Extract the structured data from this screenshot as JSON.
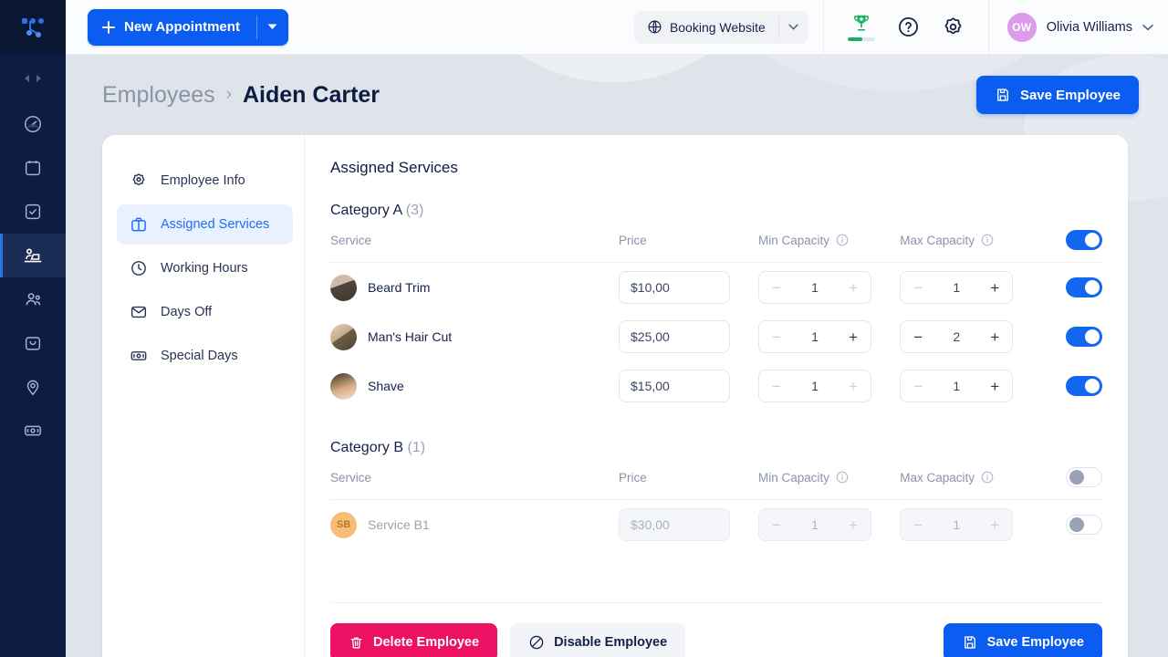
{
  "rail": {
    "logo_name": "app-logo",
    "collapse_label": "collapse-sidebar",
    "items": [
      {
        "name": "dashboard",
        "icon": "speedometer-icon",
        "active": false
      },
      {
        "name": "calendar",
        "icon": "calendar-icon",
        "active": false
      },
      {
        "name": "tasks",
        "icon": "checkbox-icon",
        "active": false
      },
      {
        "name": "employees",
        "icon": "employee-icon",
        "active": true
      },
      {
        "name": "customers",
        "icon": "customers-icon",
        "active": false
      },
      {
        "name": "packages",
        "icon": "box-icon",
        "active": false
      },
      {
        "name": "locations",
        "icon": "location-pin-icon",
        "active": false
      },
      {
        "name": "finance",
        "icon": "banknote-icon",
        "active": false
      }
    ]
  },
  "topbar": {
    "new_appointment_label": "New Appointment",
    "booking_website_label": "Booking Website",
    "trophy_progress_percent": 55,
    "user": {
      "initials": "OW",
      "name": "Olivia Williams",
      "avatar_color": "#dd9ce9"
    }
  },
  "page_header": {
    "breadcrumb_parent": "Employees",
    "breadcrumb_separator": "›",
    "breadcrumb_current": "Aiden Carter",
    "save_label": "Save Employee"
  },
  "card_nav": {
    "items": [
      {
        "label": "Employee Info",
        "icon": "gear-icon",
        "active": false
      },
      {
        "label": "Assigned Services",
        "icon": "briefcase-icon",
        "active": true
      },
      {
        "label": "Working Hours",
        "icon": "clock-icon",
        "active": false
      },
      {
        "label": "Days Off",
        "icon": "envelope-icon",
        "active": false
      },
      {
        "label": "Special Days",
        "icon": "banknote-icon",
        "active": false
      }
    ]
  },
  "content": {
    "title": "Assigned Services",
    "columns": {
      "service": "Service",
      "price": "Price",
      "min_capacity": "Min Capacity",
      "max_capacity": "Max Capacity"
    },
    "categories": [
      {
        "name": "Category A",
        "count": "(3)",
        "enabled": true,
        "header_toggle_on": true,
        "rows": [
          {
            "service": "Beard Trim",
            "avatar_type": "photo",
            "avatar_colors": [
              "#5a5246",
              "#c9b9a6"
            ],
            "price": "$10,00",
            "min_capacity": "1",
            "min_minus_enabled": false,
            "min_plus_enabled": false,
            "max_capacity": "1",
            "max_minus_enabled": false,
            "max_plus_enabled": true,
            "toggle_on": true
          },
          {
            "service": "Man's Hair Cut",
            "avatar_type": "photo",
            "avatar_colors": [
              "#8b7a63",
              "#d8c6ad"
            ],
            "price": "$25,00",
            "min_capacity": "1",
            "min_minus_enabled": false,
            "min_plus_enabled": true,
            "max_capacity": "2",
            "max_minus_enabled": true,
            "max_plus_enabled": true,
            "toggle_on": true
          },
          {
            "service": "Shave",
            "avatar_type": "photo",
            "avatar_colors": [
              "#c9a07a",
              "#7a6a55"
            ],
            "price": "$15,00",
            "min_capacity": "1",
            "min_minus_enabled": false,
            "min_plus_enabled": false,
            "max_capacity": "1",
            "max_minus_enabled": false,
            "max_plus_enabled": true,
            "toggle_on": true
          }
        ]
      },
      {
        "name": "Category B",
        "count": "(1)",
        "enabled": false,
        "header_toggle_on": false,
        "rows": [
          {
            "service": "Service B1",
            "avatar_type": "initials",
            "avatar_initials": "SB",
            "avatar_bg": "#f7bd76",
            "avatar_fg": "#b9792a",
            "price": "$30,00",
            "min_capacity": "1",
            "min_minus_enabled": false,
            "min_plus_enabled": false,
            "max_capacity": "1",
            "max_minus_enabled": false,
            "max_plus_enabled": false,
            "toggle_on": false
          }
        ]
      }
    ]
  },
  "footer": {
    "delete_label": "Delete Employee",
    "disable_label": "Disable Employee",
    "save_label": "Save Employee"
  },
  "colors": {
    "primary_blue": "#0b5cf1",
    "toggle_blue": "#1366f0",
    "danger_pink": "#ed1164",
    "rail_navy": "#0d1c42",
    "success_green": "#16b364",
    "page_bg": "#dfe3ea"
  }
}
